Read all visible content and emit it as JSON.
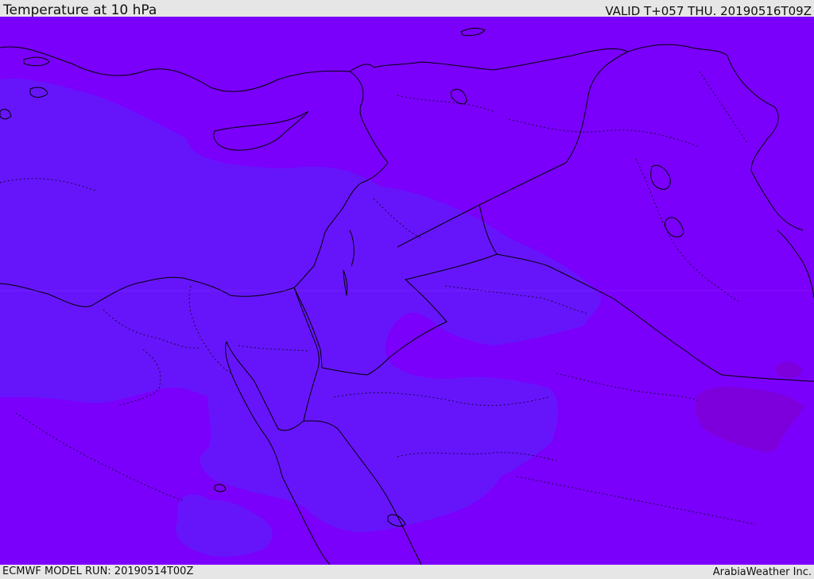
{
  "header": {
    "title": "Temperature at 10 hPa",
    "valid_time": "VALID T+057 THU. 20190516T09Z"
  },
  "footer": {
    "model_run": "ECMWF MODEL RUN: 20190514T00Z",
    "credit": "ArabiaWeather Inc."
  },
  "map": {
    "colors": {
      "warmer_field": "#7a00fb",
      "cooler_field": "#6615fb",
      "warmest_patch": "#7d00dc",
      "border_line": "#000000"
    }
  }
}
